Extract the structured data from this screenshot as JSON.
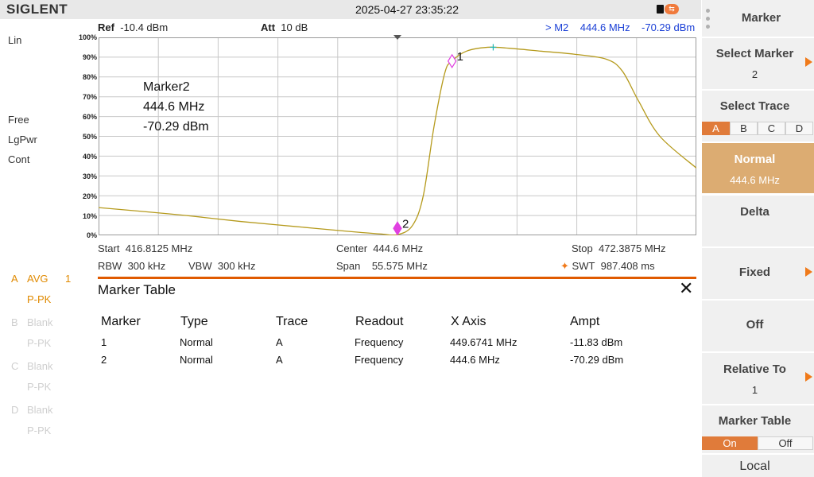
{
  "header": {
    "brand": "SIGLENT",
    "datetime": "2025-04-27 23:35:22"
  },
  "left_panel": {
    "scale": "Lin",
    "trigger": "Free",
    "detector": "LgPwr",
    "sweep_mode": "Cont",
    "traces": [
      {
        "letter": "A",
        "mode": "AVG",
        "count": "1",
        "detector": "P-PK",
        "active": true
      },
      {
        "letter": "B",
        "mode": "Blank",
        "detector": "P-PK",
        "active": false
      },
      {
        "letter": "C",
        "mode": "Blank",
        "detector": "P-PK",
        "active": false
      },
      {
        "letter": "D",
        "mode": "Blank",
        "detector": "P-PK",
        "active": false
      }
    ]
  },
  "graph_header": {
    "ref_label": "Ref",
    "ref_value": "-10.4 dBm",
    "att_label": "Att",
    "att_value": "10 dB",
    "marker_readout": "> M2    444.6 MHz    -70.29 dBm"
  },
  "y_axis_labels": [
    "100%",
    "90%",
    "80%",
    "70%",
    "60%",
    "50%",
    "40%",
    "30%",
    "20%",
    "10%",
    "0%"
  ],
  "marker_info": {
    "name": "Marker2",
    "freq": "444.6 MHz",
    "ampt": "-70.29 dBm"
  },
  "chart_data": {
    "type": "line",
    "x_unit": "MHz",
    "y_unit": "%",
    "xlim": [
      416.8125,
      472.3875
    ],
    "ylim": [
      0,
      100
    ],
    "grid": true,
    "series": [
      {
        "color": "#b59a1c",
        "x": [
          416.81,
          420.0,
          425.0,
          430.0,
          435.0,
          440.0,
          443.0,
          444.6,
          446.0,
          447.0,
          448.0,
          449.0,
          449.67,
          451.0,
          453.0,
          455.0,
          458.0,
          461.0,
          464.0,
          465.5,
          467.0,
          469.0,
          472.39
        ],
        "y": [
          14.0,
          12.5,
          10.0,
          7.0,
          4.5,
          2.0,
          0.7,
          0.3,
          5.0,
          20.0,
          55.0,
          82.0,
          88.0,
          93.0,
          95.0,
          94.5,
          93.0,
          91.5,
          89.0,
          83.0,
          68.0,
          50.0,
          34.0
        ]
      }
    ],
    "markers": [
      {
        "label": "1",
        "x": 449.6741,
        "y": 88.0,
        "symbol": "diamond-open",
        "color": "#e040e0"
      },
      {
        "label": "2",
        "x": 444.6,
        "y": 3.5,
        "symbol": "diamond-filled",
        "color": "#e040e0"
      }
    ],
    "peak_cross": {
      "x": 453.5,
      "y": 95.0,
      "color": "#1fb5b5"
    }
  },
  "freq_info": {
    "start_label": "Start",
    "start_value": "416.8125 MHz",
    "center_label": "Center",
    "center_value": "444.6 MHz",
    "stop_label": "Stop",
    "stop_value": "472.3875 MHz",
    "rbw_label": "RBW",
    "rbw_value": "300 kHz",
    "vbw_label": "VBW",
    "vbw_value": "300 kHz",
    "span_label": "Span",
    "span_value": "55.575 MHz",
    "swt_label": "SWT",
    "swt_value": "987.408 ms"
  },
  "marker_table": {
    "title": "Marker Table",
    "close": "✕",
    "columns": [
      "Marker",
      "Type",
      "Trace",
      "Readout",
      "X Axis",
      "Ampt"
    ],
    "rows": [
      [
        "1",
        "Normal",
        "A",
        "Frequency",
        "449.6741 MHz",
        "-11.83 dBm"
      ],
      [
        "2",
        "Normal",
        "A",
        "Frequency",
        "444.6 MHz",
        "-70.29 dBm"
      ]
    ]
  },
  "softkeys": {
    "menu_title": "Marker",
    "select_marker_label": "Select Marker",
    "select_marker_value": "2",
    "select_trace_label": "Select Trace",
    "trace_options": [
      "A",
      "B",
      "C",
      "D"
    ],
    "normal_label": "Normal",
    "normal_value": "444.6 MHz",
    "delta_label": "Delta",
    "fixed_label": "Fixed",
    "off_label": "Off",
    "relative_to_label": "Relative To",
    "relative_to_value": "1",
    "marker_table_label": "Marker Table",
    "marker_table_options": [
      "On",
      "Off"
    ],
    "local_label": "Local"
  }
}
